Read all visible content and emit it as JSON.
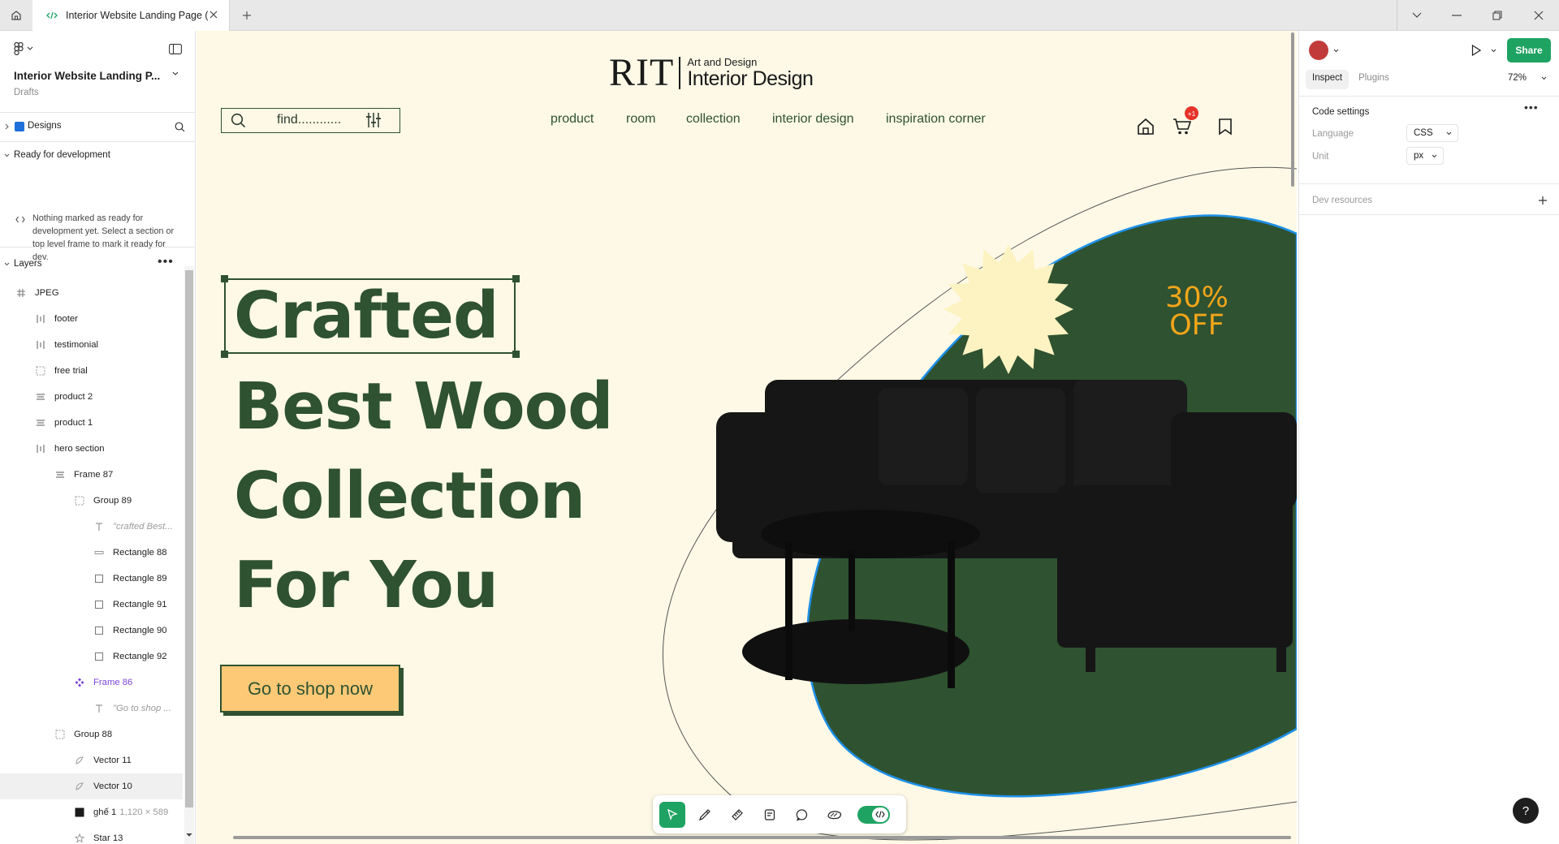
{
  "window": {
    "tab_title": "Interior Website Landing Page (C"
  },
  "left_panel": {
    "file_name": "Interior Website Landing P...",
    "location": "Drafts",
    "pages_label": "Designs",
    "ready_header": "Ready for development",
    "ready_message": "Nothing marked as ready for development yet. Select a section or top level frame to mark it ready for dev.",
    "layers_header": "Layers",
    "layers": [
      {
        "label": "JPEG",
        "icon": "frame-hash-icon",
        "indent": 0
      },
      {
        "label": "footer",
        "icon": "auto-layout-vertical-icon",
        "indent": 1
      },
      {
        "label": "testimonial",
        "icon": "auto-layout-vertical-icon",
        "indent": 1
      },
      {
        "label": "free trial",
        "icon": "group-dashed-icon",
        "indent": 1
      },
      {
        "label": "product 2",
        "icon": "auto-layout-rows-icon",
        "indent": 1
      },
      {
        "label": "product 1",
        "icon": "auto-layout-rows-icon",
        "indent": 1
      },
      {
        "label": "hero section",
        "icon": "auto-layout-vertical-icon",
        "indent": 1
      },
      {
        "label": "Frame 87",
        "icon": "auto-layout-rows-icon",
        "indent": 2
      },
      {
        "label": "Group 89",
        "icon": "group-dashed-icon",
        "indent": 3
      },
      {
        "label": "\"crafted Best...",
        "icon": "text-icon",
        "indent": 4
      },
      {
        "label": "Rectangle 88",
        "icon": "rectangle-line-icon",
        "indent": 4
      },
      {
        "label": "Rectangle 89",
        "icon": "rectangle-icon",
        "indent": 4
      },
      {
        "label": "Rectangle 91",
        "icon": "rectangle-icon",
        "indent": 4
      },
      {
        "label": "Rectangle 90",
        "icon": "rectangle-icon",
        "indent": 4
      },
      {
        "label": "Rectangle 92",
        "icon": "rectangle-icon",
        "indent": 4
      },
      {
        "label": "Frame 86",
        "icon": "component-icon",
        "indent": 3
      },
      {
        "label": "\"Go to shop ...",
        "icon": "text-icon",
        "indent": 4
      },
      {
        "label": "Group 88",
        "icon": "group-dashed-icon",
        "indent": 2
      },
      {
        "label": "Vector 11",
        "icon": "vector-icon",
        "indent": 3
      },
      {
        "label": "Vector 10",
        "icon": "vector-icon",
        "indent": 3
      },
      {
        "label": "ghế 1",
        "meta": "1,120 × 589",
        "icon": "image-icon",
        "indent": 3
      },
      {
        "label": "Star 13",
        "icon": "star-icon",
        "indent": 3
      }
    ]
  },
  "canvas": {
    "brand": {
      "mark": "RIT",
      "sub1": "Art and Design",
      "sub2": "Interior Design"
    },
    "search_placeholder": "find............",
    "nav": [
      "product",
      "room",
      "collection",
      "interior design",
      "inspiration corner"
    ],
    "cart_badge": "+1",
    "hero": [
      "Crafted",
      "Best Wood",
      "Collection",
      "For You"
    ],
    "promo": {
      "line1": "30%",
      "line2": "OFF"
    },
    "cta_label": "Go to shop now",
    "colors": {
      "background": "#fdf9e6",
      "primary": "#2f5230",
      "accent": "#fdc977",
      "promo": "#f2a51a",
      "starburst": "#fdf3c2",
      "selection": "#1e90e8"
    }
  },
  "right_panel": {
    "share_label": "Share",
    "tabs": [
      "Inspect",
      "Plugins"
    ],
    "zoom": "72%",
    "code_settings_title": "Code settings",
    "language_label": "Language",
    "language_value": "CSS",
    "unit_label": "Unit",
    "unit_value": "px",
    "dev_resources_label": "Dev resources",
    "help_label": "?"
  }
}
